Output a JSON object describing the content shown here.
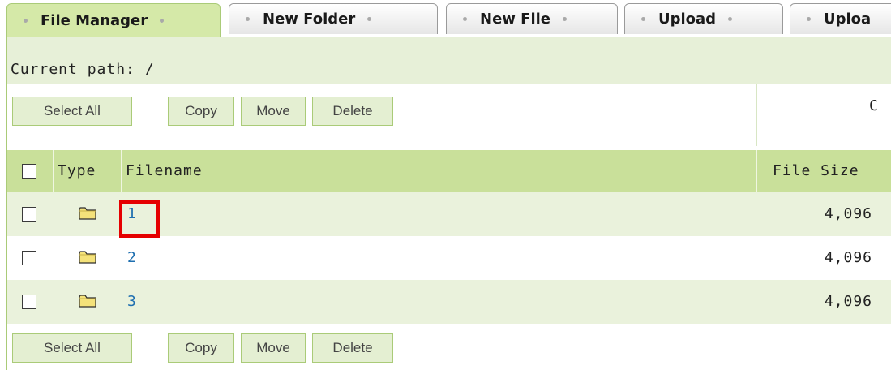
{
  "tabs": [
    {
      "label": "File Manager",
      "active": true
    },
    {
      "label": "New Folder",
      "active": false
    },
    {
      "label": "New File",
      "active": false
    },
    {
      "label": "Upload",
      "active": false
    },
    {
      "label": "Uploa",
      "active": false
    }
  ],
  "path": {
    "text": "Current path: /"
  },
  "actions": {
    "select_all": "Select All",
    "copy": "Copy",
    "move": "Move",
    "delete": "Delete",
    "truncated_right_text": "C"
  },
  "table": {
    "columns": {
      "type": "Type",
      "filename": "Filename",
      "size": "File Size"
    },
    "rows": [
      {
        "name": "1",
        "type_icon": "folder-icon",
        "size": "4,096"
      },
      {
        "name": "2",
        "type_icon": "folder-icon",
        "size": "4,096"
      },
      {
        "name": "3",
        "type_icon": "folder-icon",
        "size": "4,096"
      }
    ]
  },
  "footer_actions": {
    "select_all": "Select All",
    "copy": "Copy",
    "move": "Move",
    "delete": "Delete"
  },
  "colors": {
    "accent_green": "#c9e09a",
    "row_alt": "#eaf2dc",
    "link_blue": "#1e6fb0",
    "highlight_red": "#e50000"
  }
}
